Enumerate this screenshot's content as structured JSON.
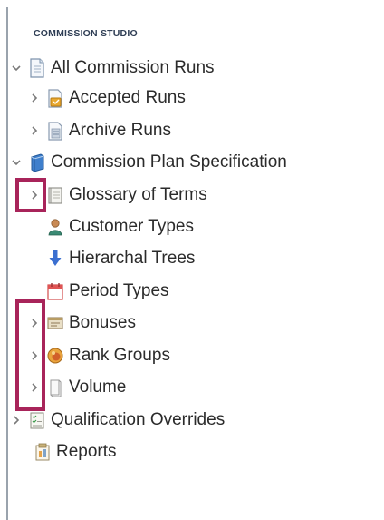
{
  "section_title": "COMMISSION STUDIO",
  "tree": {
    "all_runs": {
      "label": "All Commission Runs",
      "icon": "document-icon",
      "expanded": true
    },
    "accepted_runs": {
      "label": "Accepted Runs",
      "icon": "accepted-runs-icon",
      "expanded": false
    },
    "archive_runs": {
      "label": "Archive Runs",
      "icon": "archive-runs-icon",
      "expanded": false
    },
    "plan_spec": {
      "label": "Commission Plan Specification",
      "icon": "book-stack-icon",
      "expanded": true
    },
    "glossary": {
      "label": "Glossary of Terms",
      "icon": "glossary-icon",
      "expanded": false
    },
    "customer_types": {
      "label": "Customer Types",
      "icon": "person-icon"
    },
    "hierarchal_trees": {
      "label": "Hierarchal Trees",
      "icon": "arrow-down-icon"
    },
    "period_types": {
      "label": "Period Types",
      "icon": "calendar-icon"
    },
    "bonuses": {
      "label": "Bonuses",
      "icon": "bonus-icon",
      "expanded": false
    },
    "rank_groups": {
      "label": "Rank Groups",
      "icon": "rank-badge-icon",
      "expanded": false
    },
    "volume": {
      "label": "Volume",
      "icon": "volume-icon",
      "expanded": false
    },
    "qualification_overrides": {
      "label": "Qualification Overrides",
      "icon": "checklist-icon",
      "expanded": false
    },
    "reports": {
      "label": "Reports",
      "icon": "reports-icon"
    }
  },
  "colors": {
    "highlight": "#a8245a",
    "section_title": "#2f3e55",
    "tree_text": "#2b2b2b",
    "chevron": "#7a7a7a"
  }
}
